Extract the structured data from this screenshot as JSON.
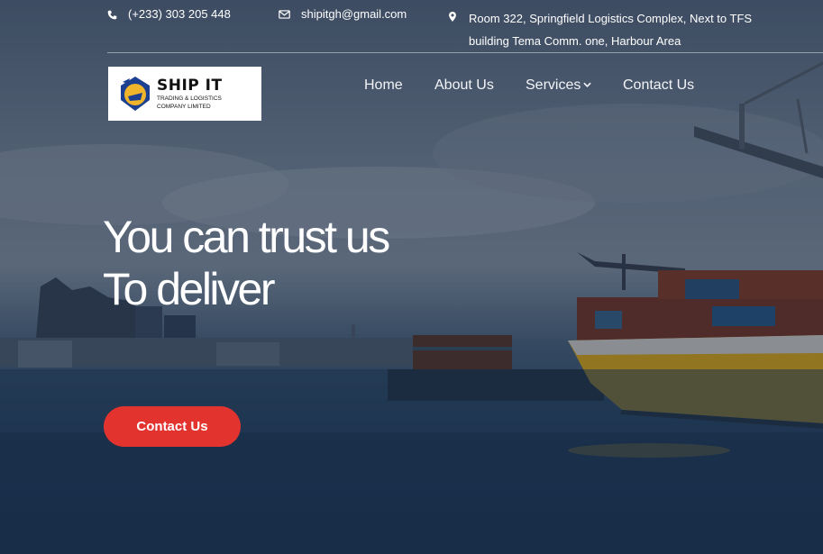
{
  "topbar": {
    "phone": "(+233) 303 205 448",
    "email": "shipitgh@gmail.com",
    "address_line1": "Room 322, Springfield Logistics Complex, Next to TFS",
    "address_line2": "building Tema Comm. one, Harbour Area",
    "icons": [
      "phone-icon",
      "envelope-icon",
      "map-marker-icon"
    ]
  },
  "logo": {
    "title": "SHIP IT",
    "subtitle_line1": "TRADING & LOGISTICS",
    "subtitle_line2": "COMPANY LIMITED"
  },
  "nav": {
    "items": [
      {
        "label": "Home"
      },
      {
        "label": "About Us"
      },
      {
        "label": "Services",
        "has_dropdown": true
      },
      {
        "label": "Contact Us"
      }
    ]
  },
  "hero": {
    "headline_line1": "You can trust us",
    "headline_line2": "To deliver",
    "cta_label": "Contact Us"
  },
  "colors": {
    "accent": "#e3332f",
    "text": "#ffffff",
    "ship_hull": "#e6b11e"
  }
}
